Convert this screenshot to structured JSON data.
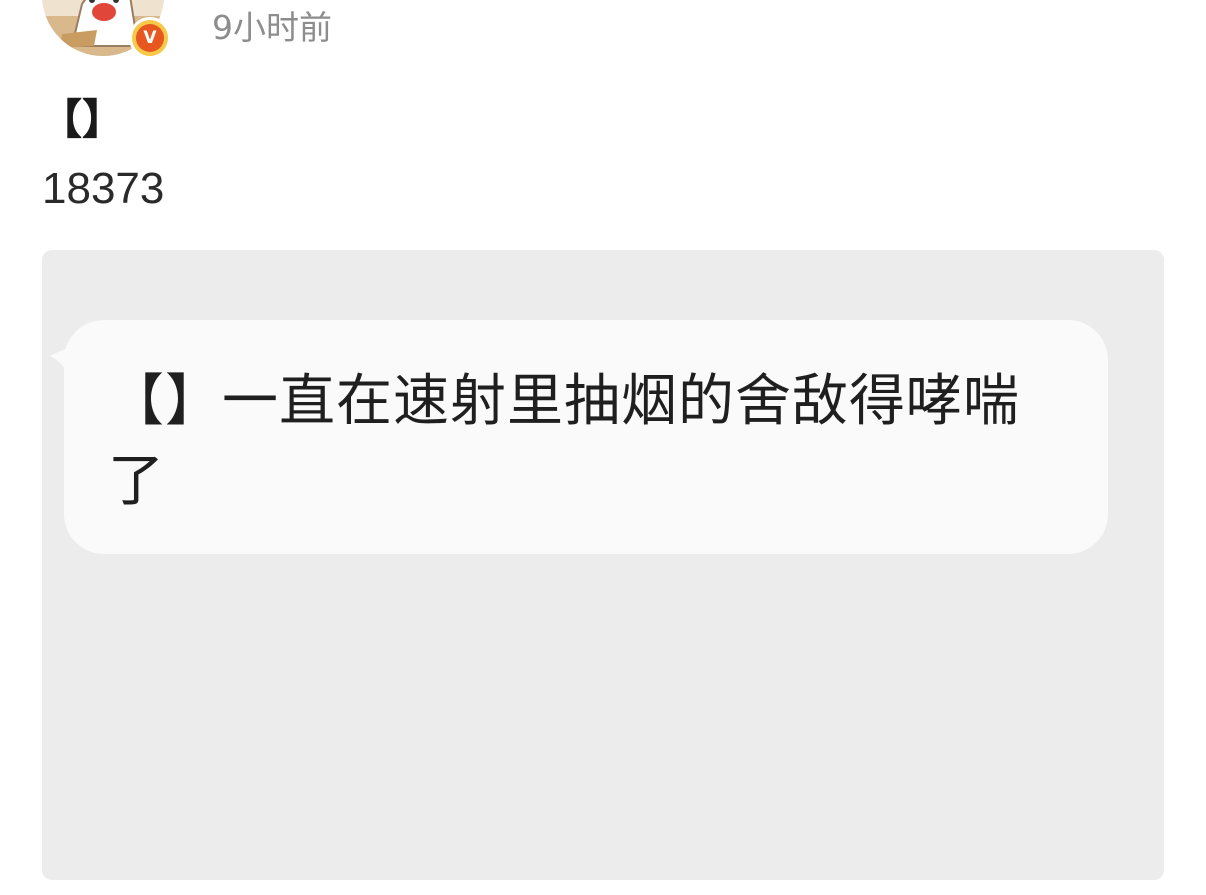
{
  "post": {
    "timestamp": "9小时前",
    "title": "【】",
    "number": "18373"
  },
  "image": {
    "bubble_text": "【】一直在速射里抽烟的舍敌得哮喘了"
  },
  "icons": {
    "avatar": "avatar-image",
    "verified": "verified-v-badge-icon",
    "verified_letter": "V"
  },
  "colors": {
    "timestamp": "#8d8d8d",
    "badge_outer": "#f7c948",
    "badge_inner": "#e8571f",
    "card_bg": "#ececec",
    "bubble_bg": "#fafafa"
  }
}
